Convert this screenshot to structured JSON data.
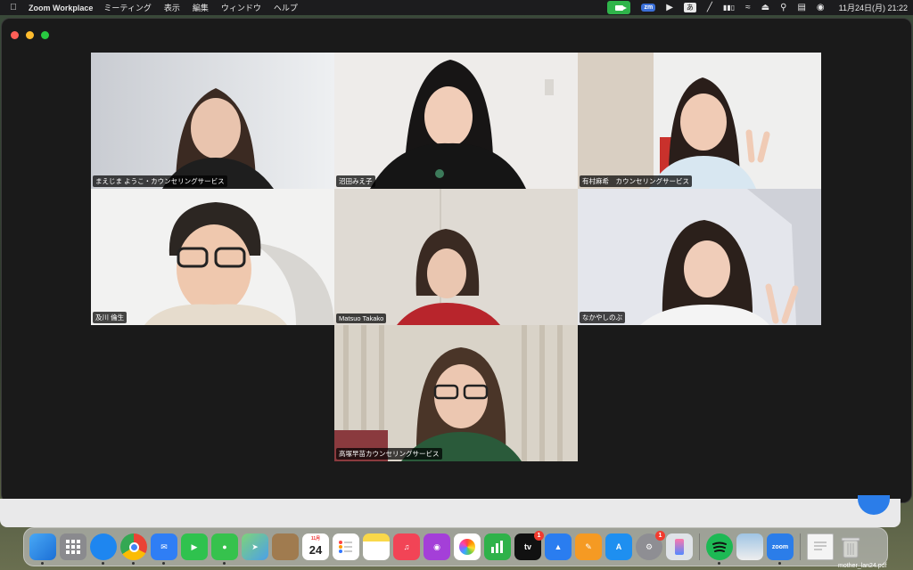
{
  "menubar": {
    "app_name": "Zoom Workplace",
    "menus": [
      "ミーティング",
      "表示",
      "編集",
      "ウィンドウ",
      "ヘルプ"
    ],
    "zm_label": "zm",
    "ime_label": "あ",
    "clock": "11月24日(月)  21:22"
  },
  "participants": [
    {
      "name": "まえじま ようこ・カウンセリングサービス",
      "active": false
    },
    {
      "name": "沼田みえ子",
      "active": true
    },
    {
      "name": "有村麻希　カウンセリングサービス",
      "active": false
    },
    {
      "name": "及川 倫生",
      "active": false
    },
    {
      "name": "Matsuo Takako",
      "active": false
    },
    {
      "name": "なかやしのぶ",
      "active": false
    },
    {
      "name": "高塚早苗カウンセリングサービス",
      "active": false
    }
  ],
  "dock": {
    "calendar_month": "11月",
    "calendar_day": "24",
    "tv_label": "tv",
    "zoom_label": "zoom",
    "badge_tv": "1",
    "badge_settings": "1",
    "file_label": "mother_lan24.pdf"
  },
  "colors": {
    "active_speaker": "#2ea043",
    "zoom_blue": "#2b7de9",
    "window_bg": "#1a1a1a"
  }
}
